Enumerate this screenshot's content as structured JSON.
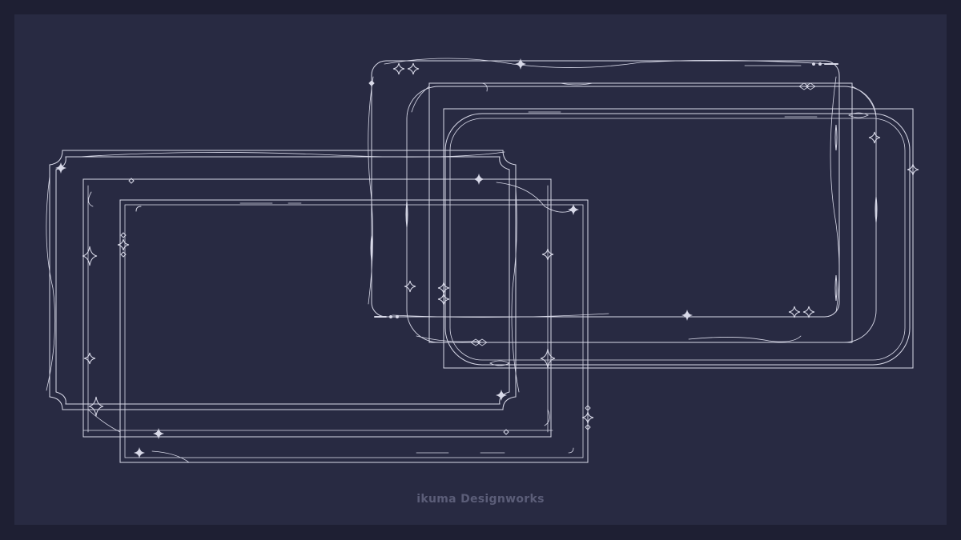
{
  "credit": {
    "text": "ikuma Designworks"
  },
  "colors": {
    "outer_border": "#1e1f33",
    "panel_background": "#282a42",
    "line": "#d8d9e8",
    "credit_text": "#5b5d78"
  },
  "frames": [
    {
      "name": "frame-ornate-scalloped-left",
      "style": "scalloped corners with inner double rule"
    },
    {
      "name": "frame-dotted-rule-left",
      "style": "thin rule with diamond and sparkle accents"
    },
    {
      "name": "frame-simple-double-left",
      "style": "plain double-line rectangle"
    },
    {
      "name": "frame-rounded-wavy-right",
      "style": "rounded corners with wavy ribbon line"
    },
    {
      "name": "frame-flourish-right",
      "style": "rounded rectangle with curling flourishes"
    },
    {
      "name": "frame-rounded-double-right",
      "style": "rounded inner frame inside square outer rule"
    }
  ]
}
